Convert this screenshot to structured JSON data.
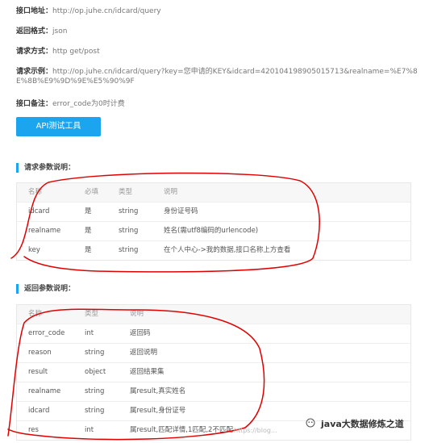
{
  "info": {
    "address_label": "接口地址：",
    "address_value": "http://op.juhe.cn/idcard/query",
    "format_label": "返回格式：",
    "format_value": "json",
    "method_label": "请求方式：",
    "method_value": "http get/post",
    "example_label": "请求示例：",
    "example_value": "http://op.juhe.cn/idcard/query?key=您申请的KEY&idcard=420104198905015713&realname=%E7%8E%8B%E9%9D%9E%E5%90%9F",
    "note_label": "接口备注：",
    "note_value": "error_code为0时计费"
  },
  "api_button": "API测试工具",
  "request_section": {
    "title": "请求参数说明：",
    "headers": [
      "名称",
      "必填",
      "类型",
      "说明"
    ],
    "rows": [
      [
        "idcard",
        "是",
        "string",
        "身份证号码"
      ],
      [
        "realname",
        "是",
        "string",
        "姓名(需utf8编码的urlencode)"
      ],
      [
        "key",
        "是",
        "string",
        "在个人中心->我的数据,接口名称上方查看"
      ]
    ]
  },
  "response_section": {
    "title": "返回参数说明：",
    "headers": [
      "名称",
      "类型",
      "说明"
    ],
    "rows": [
      [
        "error_code",
        "int",
        "返回码"
      ],
      [
        "reason",
        "string",
        "返回说明"
      ],
      [
        "result",
        "object",
        "返回结果集"
      ],
      [
        "realname",
        "string",
        "属result,真实姓名"
      ],
      [
        "idcard",
        "string",
        "属result,身份证号"
      ],
      [
        "res",
        "int",
        "属result,匹配详情,1匹配,2不匹配"
      ]
    ]
  },
  "watermark": {
    "text": "java大数据修炼之道",
    "url": "https://blog..."
  },
  "colors": {
    "accent": "#1aa5ee",
    "annotation": "#e00000"
  }
}
